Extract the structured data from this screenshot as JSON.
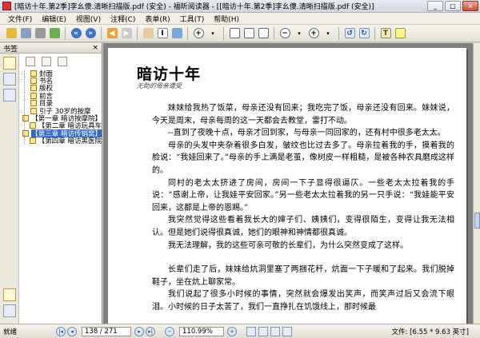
{
  "window": {
    "title": "[暗访十年.第2季]李幺傻.清晰扫描版.pdf (安全) - 福昕阅读器 - [[暗访十年.第2季]李幺傻.清晰扫描版.pdf (安全)]",
    "minimize": "_",
    "maximize": "□",
    "close": "×"
  },
  "menu": [
    "文件(F)",
    "编辑(E)",
    "视图(V)",
    "注释(C)",
    "表单(R)",
    "工具(T)",
    "帮助(H)"
  ],
  "sidebar": {
    "title": "书签",
    "close": "×",
    "bookmarks": [
      {
        "label": "封面",
        "selected": false
      },
      {
        "label": "书名",
        "selected": false
      },
      {
        "label": "版权",
        "selected": false
      },
      {
        "label": "前言",
        "selected": false
      },
      {
        "label": "目录",
        "selected": false
      },
      {
        "label": "引子  30岁的按摩",
        "selected": false
      },
      {
        "label": "【第一章  暗访按摩院】",
        "selected": false
      },
      {
        "label": "【第二章  暗访玩具车",
        "selected": false
      },
      {
        "label": "【第三章  暗访传销窝】",
        "selected": true
      },
      {
        "label": "【第四章  暗访黑医院",
        "selected": false
      }
    ]
  },
  "document": {
    "chapter_title": "暗访十年",
    "chapter_subtitle": "无助的母亲遭受",
    "paragraphs": [
      "妹妹给我热了饭菜，母亲还没有回来；我吃完了饭，母亲还没有回来。妹妹说，今天是周末，母亲每周的这一天都会去教堂，雷打不动。",
      "--直到了夜晚十点，母亲才回到家，与母亲一同回家的，还有村中很多老太太。",
      "母亲的头发中夹杂着很多白发，皱纹也比过去多了。母亲拉着我的手，摸着我的脸说：“我娃回来了。”母亲的手上满是老茧，像树皮一样粗糙，是被各种农具磨成这样的。",
      "同村的老太太挤进了房间，房间一下子显得很逼仄。一些老太太拉着我的手说：“感谢上帝，让我娃平安回家。”另一些老太太拉着我的另一只手说：“我娃能平安回来，这都是上帝的恩赐。”",
      "我突然觉得这些看着我长大的婶子们、姨姨们，变得很陌生，变得让我无法相认。但是她们说得很真诚，她们的眼神和神情都很真诚。",
      "我无法理解，我的这些可亲可敬的长辈们，为什么突然变成了这样。",
      "",
      "长辈们走了后，妹妹给炕洞里塞了两捆花秆，炕面一下子暖和了起来。我们脱掉鞋子，坐在炕上聊家常。",
      "我们说起了很多小时候的事情，突然就会爆发出笑声，而笑声过后又会流下眼泪。小时候的日子太苦了，我们一直挣扎在饥饿线上，那时候最"
    ]
  },
  "status": {
    "ready": "就绪",
    "first": "|◂",
    "prev": "◂",
    "page_indicator": "138 / 271",
    "next": "▸",
    "last": "▸|",
    "zoom": "110.99%",
    "file_info": "文件: [6.55 * 9.63 英寸]"
  }
}
